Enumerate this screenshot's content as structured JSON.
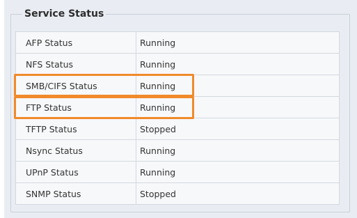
{
  "service_status": {
    "legend": "Service Status",
    "rows": [
      {
        "label": "AFP Status",
        "value": "Running",
        "state": "running"
      },
      {
        "label": "NFS Status",
        "value": "Running",
        "state": "running"
      },
      {
        "label": "SMB/CIFS Status",
        "value": "Running",
        "state": "running",
        "highlighted": true
      },
      {
        "label": "FTP Status",
        "value": "Running",
        "state": "running",
        "highlighted": true
      },
      {
        "label": "TFTP Status",
        "value": "Stopped",
        "state": "stopped"
      },
      {
        "label": "Nsync Status",
        "value": "Running",
        "state": "running"
      },
      {
        "label": "UPnP Status",
        "value": "Running",
        "state": "running"
      },
      {
        "label": "SNMP Status",
        "value": "Stopped",
        "state": "stopped"
      }
    ]
  },
  "colors": {
    "running": "#1a2fc5",
    "stopped": "#e01414",
    "highlight": "#f08a2a"
  }
}
